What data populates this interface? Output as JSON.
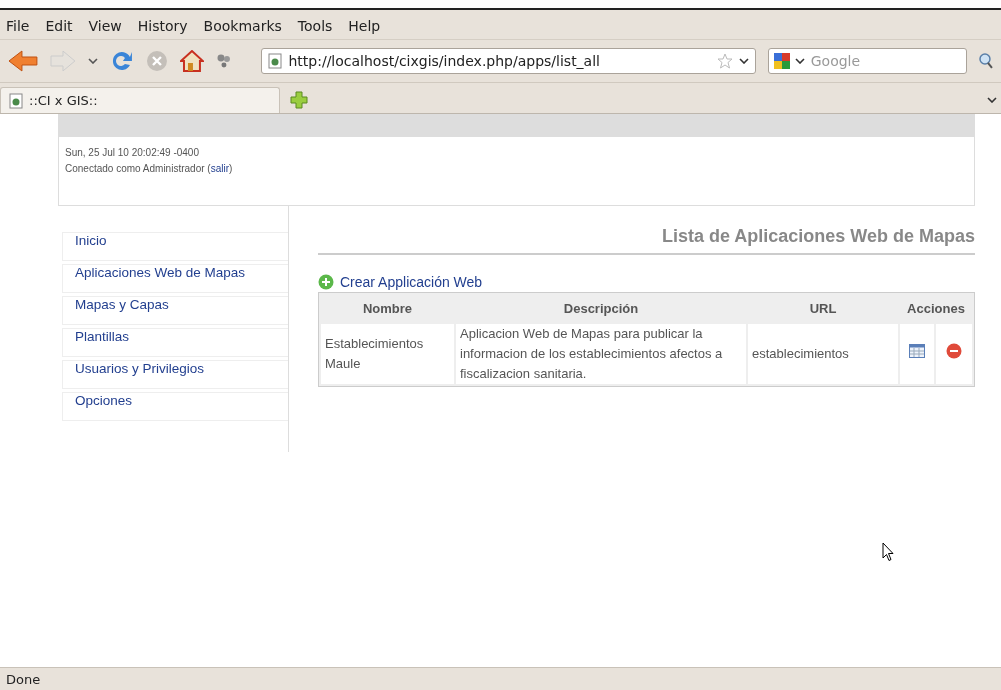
{
  "menu": [
    "File",
    "Edit",
    "View",
    "History",
    "Bookmarks",
    "Tools",
    "Help"
  ],
  "address": {
    "value": "http://localhost/cixgis/index.php/apps/list_all"
  },
  "search": {
    "placeholder": "Google"
  },
  "tabs": [
    {
      "label": "::CI x GIS::",
      "selected": true
    }
  ],
  "header": {
    "date": "Sun, 25 Jul 10 20:02:49 -0400",
    "user_prefix": "Conectado como Administrador (",
    "logout": "salir",
    "user_suffix": ")"
  },
  "sidebar": {
    "items": [
      {
        "label": "Inicio"
      },
      {
        "label": "Aplicaciones Web de Mapas"
      },
      {
        "label": "Mapas y Capas"
      },
      {
        "label": "Plantillas"
      },
      {
        "label": "Usuarios y Privilegios"
      },
      {
        "label": "Opciones"
      }
    ]
  },
  "title": "Lista de Aplicaciones Web de Mapas",
  "create_link": "Crear Applicación Web",
  "table": {
    "columns": [
      "Nombre",
      "Descripción",
      "URL",
      "Acciones"
    ],
    "rows": [
      {
        "name": "Establecimientos Maule",
        "description": "Aplicacion Web de Mapas para publicar la informacion de los establecimientos afectos a fiscalizacion sanitaria.",
        "url": "establecimientos"
      }
    ]
  },
  "status_bar": "Done"
}
